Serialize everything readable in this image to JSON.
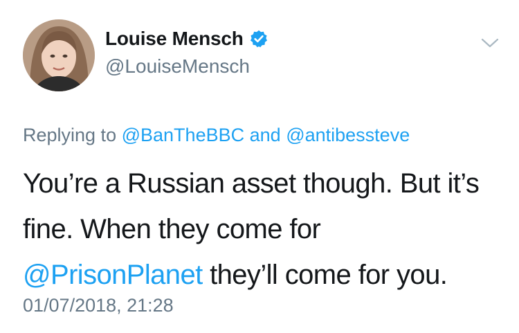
{
  "author": {
    "display_name": "Louise Mensch",
    "handle": "@LouiseMensch",
    "verified_icon": "verified-badge-icon"
  },
  "menu": {
    "icon": "chevron-down-icon"
  },
  "reply": {
    "prefix": "Replying to",
    "mention_1": "@BanTheBBC",
    "conjunction": "and",
    "mention_2": "@antibessteve"
  },
  "tweet": {
    "line1": "You’re a Russian asset though. But it’s",
    "line2": "fine. When they come for",
    "mention": "@PrisonPlanet",
    "line3_rest": " they’ll come for you."
  },
  "timestamp": "01/07/2018, 21:28",
  "colors": {
    "link": "#1da1f2",
    "muted": "#657786",
    "text": "#14171a"
  }
}
